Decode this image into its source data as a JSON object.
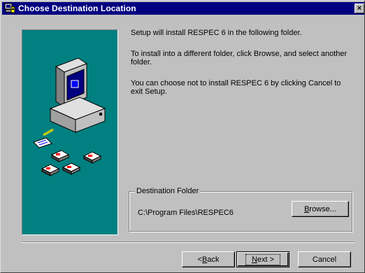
{
  "window": {
    "title": "Choose Destination Location",
    "close_glyph": "×",
    "icon": "setup-computer-icon"
  },
  "messages": {
    "line1": "Setup will install RESPEC 6 in the following folder.",
    "line2": "To install into a different folder, click Browse, and select another folder.",
    "line3": "You can choose not to install RESPEC 6 by clicking Cancel to exit Setup."
  },
  "destination": {
    "group_label": "Destination Folder",
    "path": "C:\\Program Files\\RESPEC6",
    "browse_prefix": "B",
    "browse_rest": "rowse..."
  },
  "buttons": {
    "back_prefix": "< ",
    "back_accel": "B",
    "back_rest": "ack",
    "next_accel": "N",
    "next_rest": "ext >",
    "cancel": "Cancel"
  },
  "colors": {
    "titlebar": "#000080",
    "dialog_face": "#c0c0c0",
    "art_background": "#008080"
  }
}
